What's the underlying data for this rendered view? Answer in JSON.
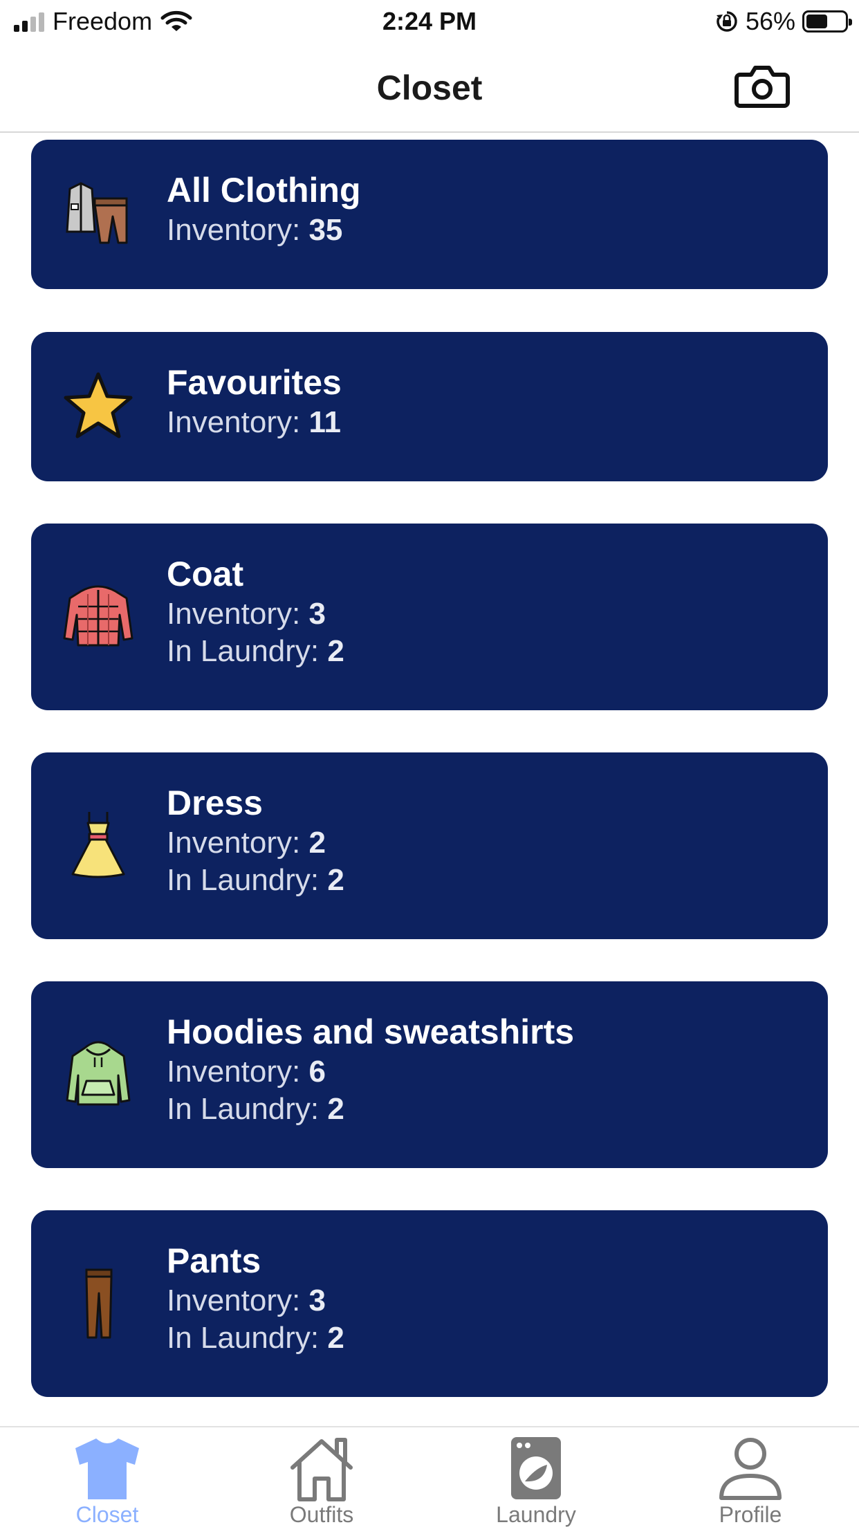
{
  "status_bar": {
    "carrier": "Freedom",
    "time": "2:24 PM",
    "battery": "56%",
    "battery_level": 0.56
  },
  "header": {
    "title": "Closet",
    "camera_icon": "camera-icon"
  },
  "categories": [
    {
      "title": "All Clothing",
      "inventory_label": "Inventory: ",
      "inventory": "35",
      "icon": "clothing-set-icon"
    },
    {
      "title": "Favourites",
      "inventory_label": "Inventory: ",
      "inventory": "11",
      "icon": "star-icon"
    },
    {
      "title": "Coat",
      "inventory_label": "Inventory: ",
      "inventory": "3",
      "laundry_label": "In Laundry: ",
      "laundry": "2",
      "icon": "puffer-coat-icon"
    },
    {
      "title": "Dress",
      "inventory_label": "Inventory: ",
      "inventory": "2",
      "laundry_label": "In Laundry: ",
      "laundry": "2",
      "icon": "dress-icon"
    },
    {
      "title": "Hoodies and sweatshirts",
      "inventory_label": "Inventory: ",
      "inventory": "6",
      "laundry_label": "In Laundry: ",
      "laundry": "2",
      "icon": "hoodie-icon"
    },
    {
      "title": "Pants",
      "inventory_label": "Inventory: ",
      "inventory": "3",
      "laundry_label": "In Laundry: ",
      "laundry": "2",
      "icon": "pants-icon"
    }
  ],
  "tabs": [
    {
      "label": "Closet",
      "icon": "tshirt-icon",
      "active": true
    },
    {
      "label": "Outfits",
      "icon": "house-icon",
      "active": false
    },
    {
      "label": "Laundry",
      "icon": "washing-machine-icon",
      "active": false
    },
    {
      "label": "Profile",
      "icon": "person-icon",
      "active": false
    }
  ],
  "colors": {
    "card_background": "#0d2260",
    "active_tab": "#8bb0ff",
    "inactive_tab": "#7a7a7a"
  }
}
